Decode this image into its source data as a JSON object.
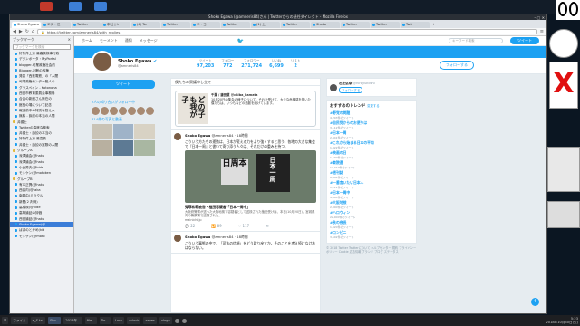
{
  "window": {
    "title": "Shoko Egawa (@amneris84)さん | Twitterからの退任ダイレクト - Mozilla Firefox",
    "controls": "– ▢ ✕"
  },
  "tabs": [
    {
      "label": "Shoko Egawa",
      "active": true
    },
    {
      "label": "エス・江"
    },
    {
      "label": "Twitter"
    },
    {
      "label": "本社 | h"
    },
    {
      "label": "(4) Tw"
    },
    {
      "label": "Twitter"
    },
    {
      "label": "エ・ヨ"
    },
    {
      "label": "Twitter"
    },
    {
      "label": "(1) 上"
    },
    {
      "label": "Twitter"
    },
    {
      "label": "Shoko"
    },
    {
      "label": "Twitter"
    },
    {
      "label": "Twitter"
    },
    {
      "label": "Twit"
    }
  ],
  "tab_new": "+",
  "nav": {
    "back": "◀",
    "forward": "▶",
    "reload": "↻",
    "home": "⌂",
    "url": "https://twitter.com/amneris84/with_replies",
    "menu": "≡"
  },
  "sidebar": {
    "title": "ブックマーク",
    "close": "×",
    "search_placeholder": "ブックマークを検索",
    "items": [
      {
        "label": "好条件上京 最高検検事行政",
        "folder": false
      },
      {
        "label": "デジンポータ・MyPortal",
        "folder": false
      },
      {
        "label": "blogger-司業政権社会的",
        "folder": false
      },
      {
        "label": "Blogger-判断の政権",
        "folder": false
      },
      {
        "label": "発表「西鉄電鉄」の「人間",
        "folder": false
      },
      {
        "label": "司場政権センター殺人の",
        "folder": false
      },
      {
        "label": "グラスペイン - Kotonoha",
        "folder": false
      },
      {
        "label": "西宮市教育委員会事務局",
        "folder": false
      },
      {
        "label": "合金の新館さん所在の",
        "folder": false
      },
      {
        "label": "館長の場について記念",
        "folder": false
      },
      {
        "label": "報道前中の特別な答え人",
        "folder": false
      },
      {
        "label": "無料 - 訴訟の本当の人間",
        "folder": false
      },
      {
        "label": "弁護士",
        "folder": true
      },
      {
        "label": "Twitterの高度な検索",
        "folder": false
      },
      {
        "label": "弁護士・訴訟の本当の",
        "folder": false
      },
      {
        "label": "好条件上京 最高検",
        "folder": false
      },
      {
        "label": "弁護士・訴訟の実際の人間",
        "folder": false
      },
      {
        "label": "グループA",
        "folder": true
      },
      {
        "label": "深澤論会(@haku",
        "folder": false
      },
      {
        "label": "深澤論会(@haku",
        "folder": false
      },
      {
        "label": "小倉秀夫(@hide",
        "folder": false
      },
      {
        "label": "モトケン(@motoken",
        "folder": false
      },
      {
        "label": "グループB",
        "folder": true
      },
      {
        "label": "有本正興(@haku",
        "folder": false
      },
      {
        "label": "西谷内(@taka",
        "folder": false
      },
      {
        "label": "南雲由(ミラクル",
        "folder": false
      },
      {
        "label": "新聞(2 判例)",
        "folder": false
      },
      {
        "label": "高橋検(@hide",
        "folder": false
      },
      {
        "label": "高等論証の評価",
        "folder": false
      },
      {
        "label": "西宮論証(@haku",
        "folder": false
      },
      {
        "label": "Shoko Egawa(@",
        "folder": false
      },
      {
        "label": "ばばのとかめ(kid",
        "folder": false
      },
      {
        "label": "モトケン(@moto",
        "folder": false
      }
    ],
    "selected_index": 30
  },
  "twitter": {
    "nav_items": [
      "ホーム",
      "モーメント",
      "通知",
      "メッセージ"
    ],
    "bird": "🐦",
    "search_placeholder": "キーワード検索",
    "tweet_button": "ツイート",
    "profile": {
      "name": "Shoko Egawa",
      "verified": "✔",
      "handle": "@amneris84",
      "stats": [
        {
          "label": "ツイート",
          "value": "97,203"
        },
        {
          "label": "フォロー",
          "value": "772"
        },
        {
          "label": "フォロワー",
          "value": "271,724"
        },
        {
          "label": "いいね",
          "value": "6,699"
        },
        {
          "label": "リスト",
          "value": "2"
        }
      ],
      "follow_button": "フォローする"
    },
    "left": {
      "tweet_to": "ツイート",
      "followers_label": "7人の知り合いがフォロー中",
      "media_label": "414件の写真と動画"
    },
    "timeline_tab": "僕たちの異議申し立て",
    "tweets": [
      {
        "name": "",
        "handle": "",
        "text": "",
        "quote_author": "千葉 / 鎌田慧 @chiba_kamata",
        "quote_text": "10月20日の集会の様子について。それを受けて、大きな危機感を抱いた僕たちは、いつもなどの活動を続けています。",
        "quote_image_text": "どの子も我が子"
      },
      {
        "name": "Shoko Egawa",
        "handle": "@amneris84 · 18時間",
        "text": "こういう方たちの運動は、日本が変える力をより強くすると思う。各地の大きな集会で『日本一周』と書いて寄り添う人々は、それだけの重みを持つ。",
        "media_signs": [
          "日周本",
          "日本一周"
        ],
        "card_title": "冤罪和罪被告・植田容疑者「日本一周中」",
        "card_text": "大阪府警察が送った大阪地検で容疑者として送検された植田受けは、本日(10月20日)、宮城県内の警察署で逮捕された。",
        "card_source": "mainichi.jp",
        "actions": [
          "💬 22",
          "🔁 89",
          "♡ 117",
          "✉"
        ]
      },
      {
        "name": "Shoko Egawa",
        "handle": "@amneris84 · 18時間",
        "text": "こういう事態の中で、「司法の信頼」をどう取り戻すか。そのことを考え続けなければならない。"
      }
    ],
    "right": {
      "follow_user": {
        "name": "石上弘幸",
        "handle": "@hiroyukiishi",
        "button": "フォローする"
      },
      "trends_title": "おすすめのトレンド",
      "trends_change": "変更する",
      "trends": [
        {
          "name": "#野党の問題",
          "count": "4,203件のツイート"
        },
        {
          "name": "#自民党からのお便りは",
          "count": "3,112件のツイート"
        },
        {
          "name": "#日本一周",
          "count": "2,941件のツイート"
        },
        {
          "name": "#これから始まる日本の平和",
          "count": "1,822件のツイート"
        },
        {
          "name": "#映画の日",
          "count": "1,530件のツイート"
        },
        {
          "name": "#衆院選",
          "count": "12,010件のツイート"
        },
        {
          "name": "#週刊誌",
          "count": "8,844件のツイート"
        },
        {
          "name": "#一番言いたい日本人",
          "count": "1,211件のツイート"
        },
        {
          "name": "#日本一周中",
          "count": "4,900件のツイート"
        },
        {
          "name": "#大阪地検",
          "count": "2,300件のツイート"
        },
        {
          "name": "#ハロウィン",
          "count": "22,000件のツイート"
        },
        {
          "name": "#秋の夜長",
          "count": "1,020件のツイート"
        },
        {
          "name": "#コンビニ",
          "count": "3,502件のツイート"
        }
      ],
      "footer": "© 2018 Twitter  Twitterについて  ヘルプセンター  規約  プライバシーポリシー  Cookie  広告情報  ブランド  ブログ  ステータス"
    },
    "scroll_top": "↑"
  },
  "taskbar": {
    "items": [
      "☰",
      "ファイル",
      "e_S.txt",
      "Sho…",
      "2018年…",
      "file…",
      "Tw…",
      "Lock",
      "xclock",
      "xeyes",
      "xlogo"
    ],
    "active_index": 3,
    "clock_time": "5:23",
    "clock_date": "2018年10月30日(火)"
  },
  "colors": {
    "twitter_blue": "#1da1f2",
    "selected_bookmark": "#3b7dd8"
  }
}
